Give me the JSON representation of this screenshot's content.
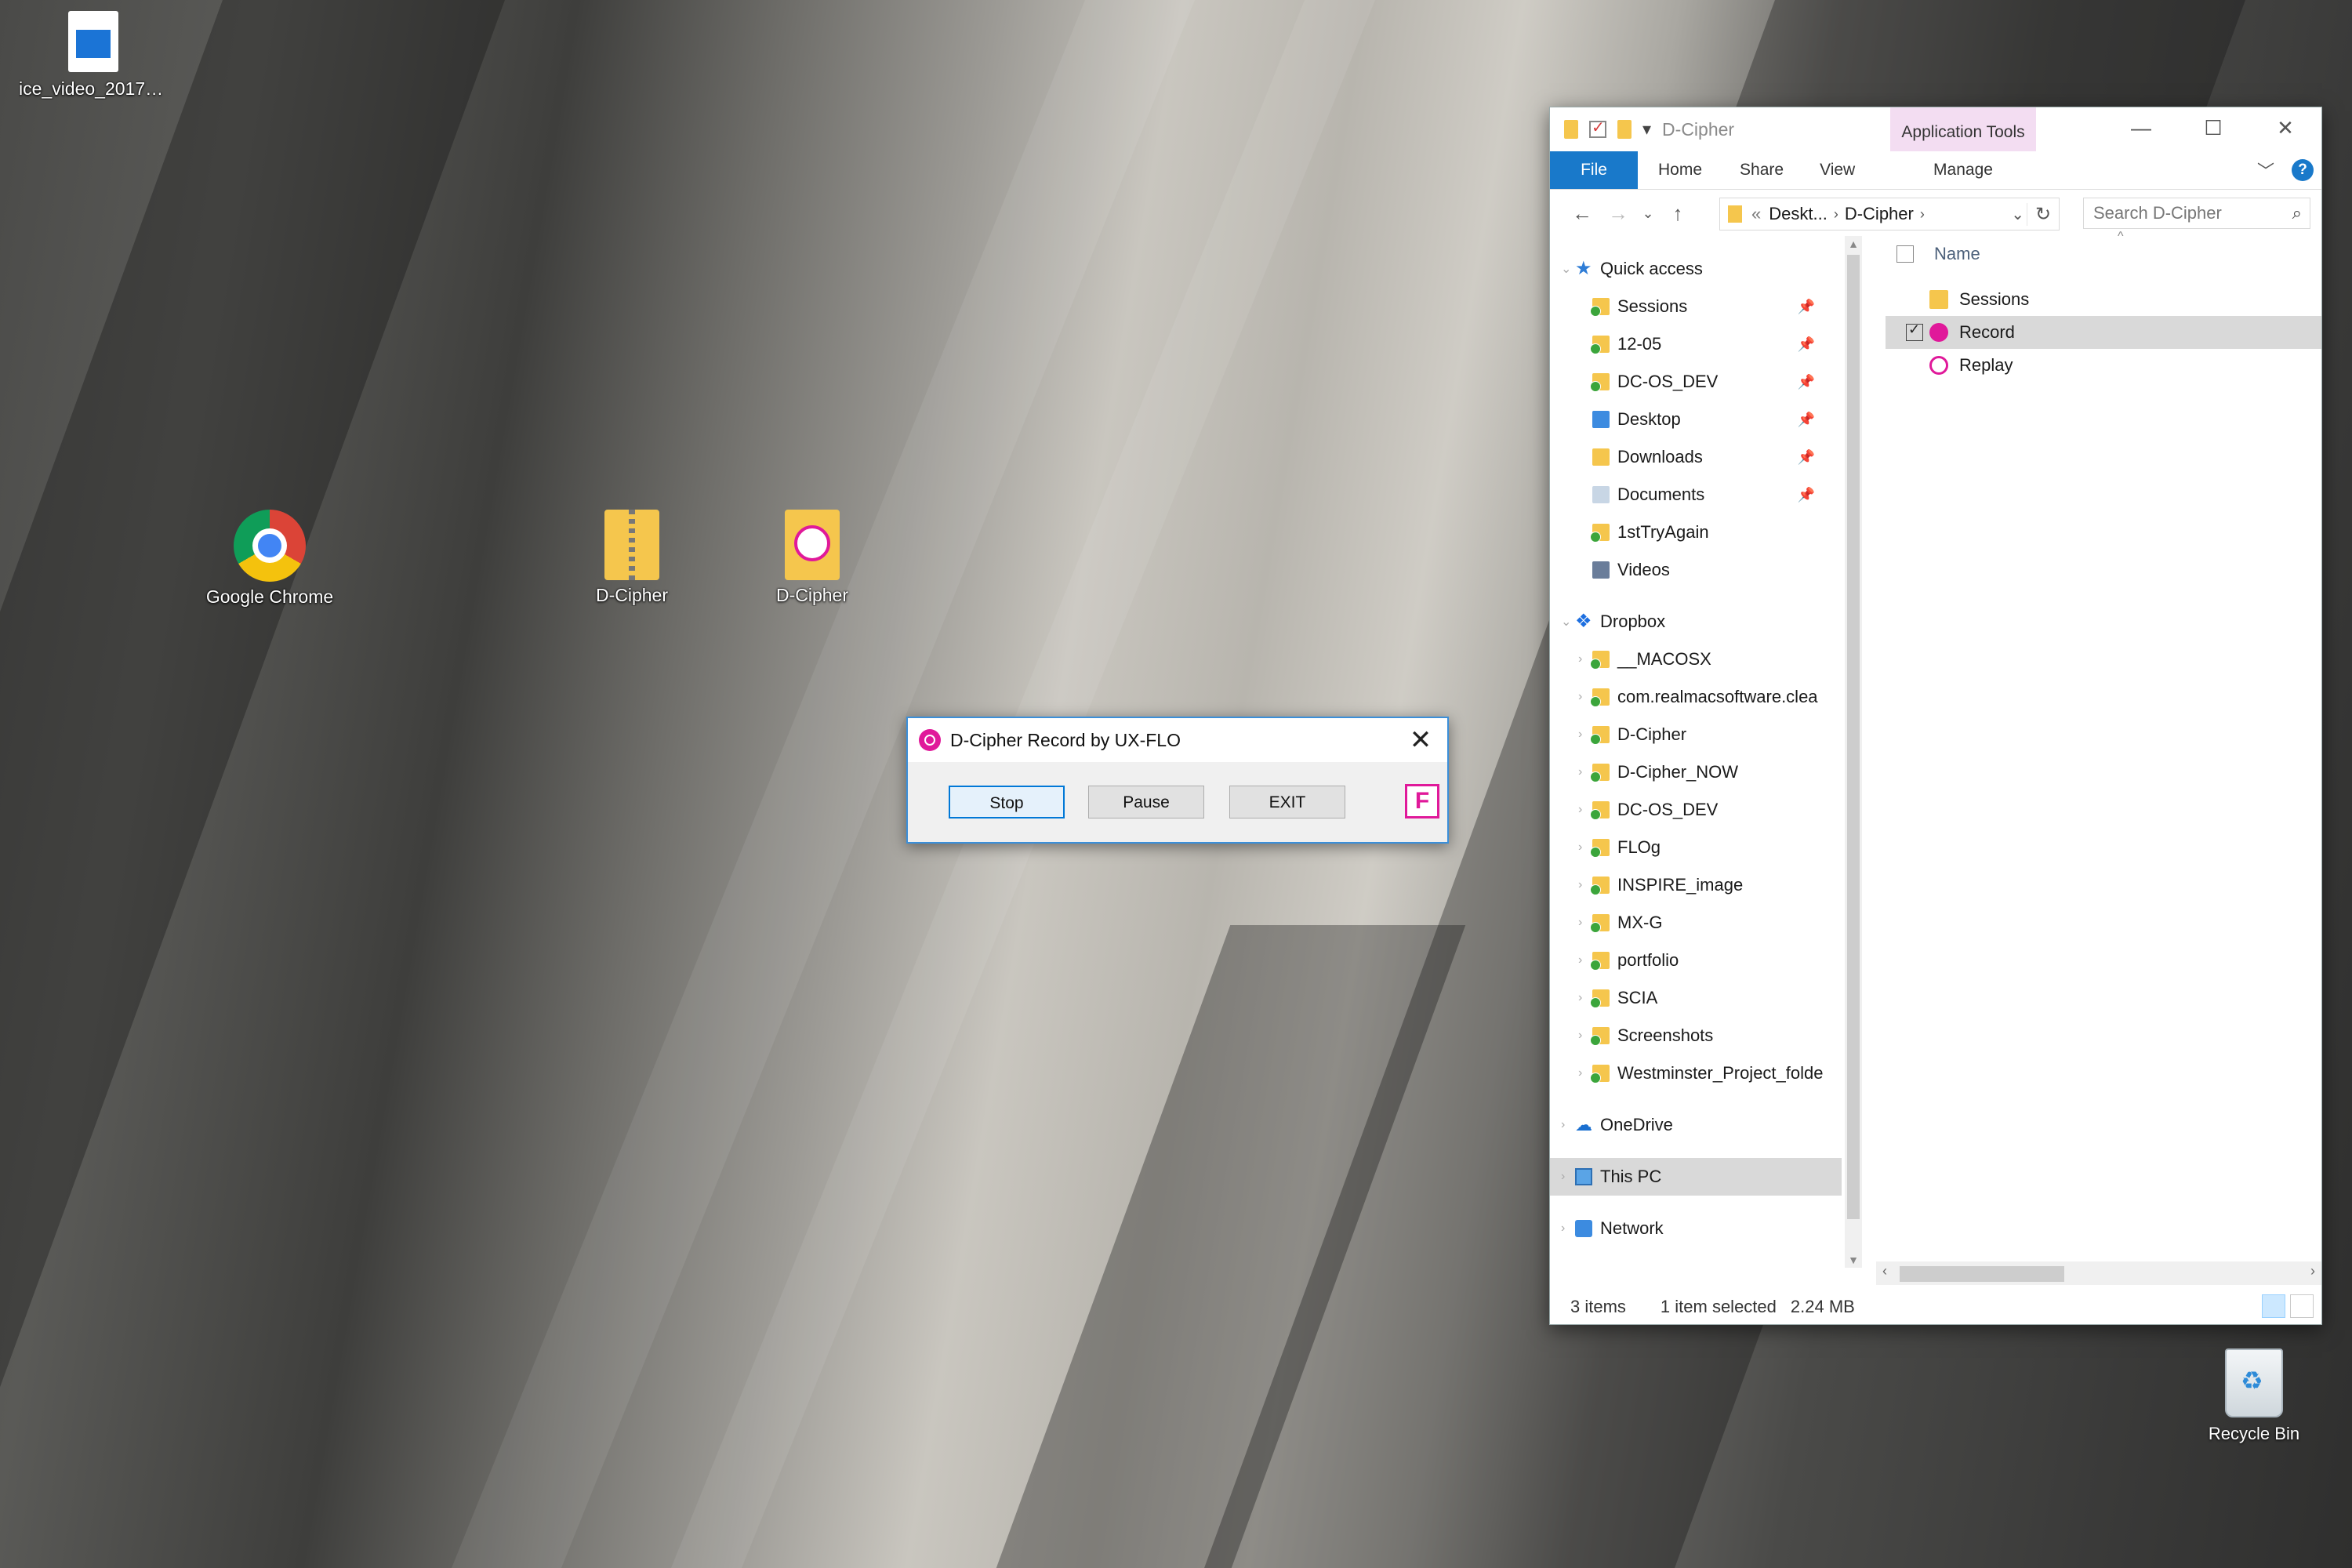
{
  "desktop": {
    "icons": [
      {
        "label": "ice_video_2017120..."
      },
      {
        "label": "Google Chrome"
      },
      {
        "label": "D-Cipher"
      },
      {
        "label": "D-Cipher"
      }
    ],
    "recycle_bin": "Recycle Bin"
  },
  "dialog": {
    "title": "D-Cipher Record by UX-FLO",
    "close": "✕",
    "buttons": {
      "stop": "Stop",
      "pause": "Pause",
      "exit": "EXIT"
    },
    "badge": "F"
  },
  "explorer": {
    "title": "D-Cipher",
    "context_tab": "Application Tools",
    "tabs": {
      "file": "File",
      "home": "Home",
      "share": "Share",
      "view": "View",
      "manage": "Manage"
    },
    "window_controls": {
      "minimize": "—",
      "maximize": "☐",
      "close": "✕"
    },
    "help": "?",
    "address": {
      "prefix": "«",
      "crumbs": [
        "Deskt...",
        "D-Cipher"
      ]
    },
    "search_placeholder": "Search D-Cipher",
    "nav": {
      "quick_access": "Quick access",
      "quick_items": [
        "Sessions",
        "12-05",
        "DC-OS_DEV",
        "Desktop",
        "Downloads",
        "Documents",
        "1stTryAgain",
        "Videos"
      ],
      "dropbox": "Dropbox",
      "dropbox_items": [
        "__MACOSX",
        "com.realmacsoftware.clea",
        "D-Cipher",
        "D-Cipher_NOW",
        "DC-OS_DEV",
        "FLOg",
        "INSPIRE_image",
        "MX-G",
        "portfolio",
        "SCIA",
        "Screenshots",
        "Westminster_Project_folde"
      ],
      "onedrive": "OneDrive",
      "this_pc": "This PC",
      "network": "Network"
    },
    "column_name": "Name",
    "files": [
      "Sessions",
      "Record",
      "Replay"
    ],
    "status": {
      "count": "3 items",
      "selected": "1 item selected",
      "size": "2.24 MB"
    }
  },
  "colors": {
    "accent": "#1979ca",
    "brand_pink": "#e0199a",
    "folder": "#f5c64d"
  }
}
